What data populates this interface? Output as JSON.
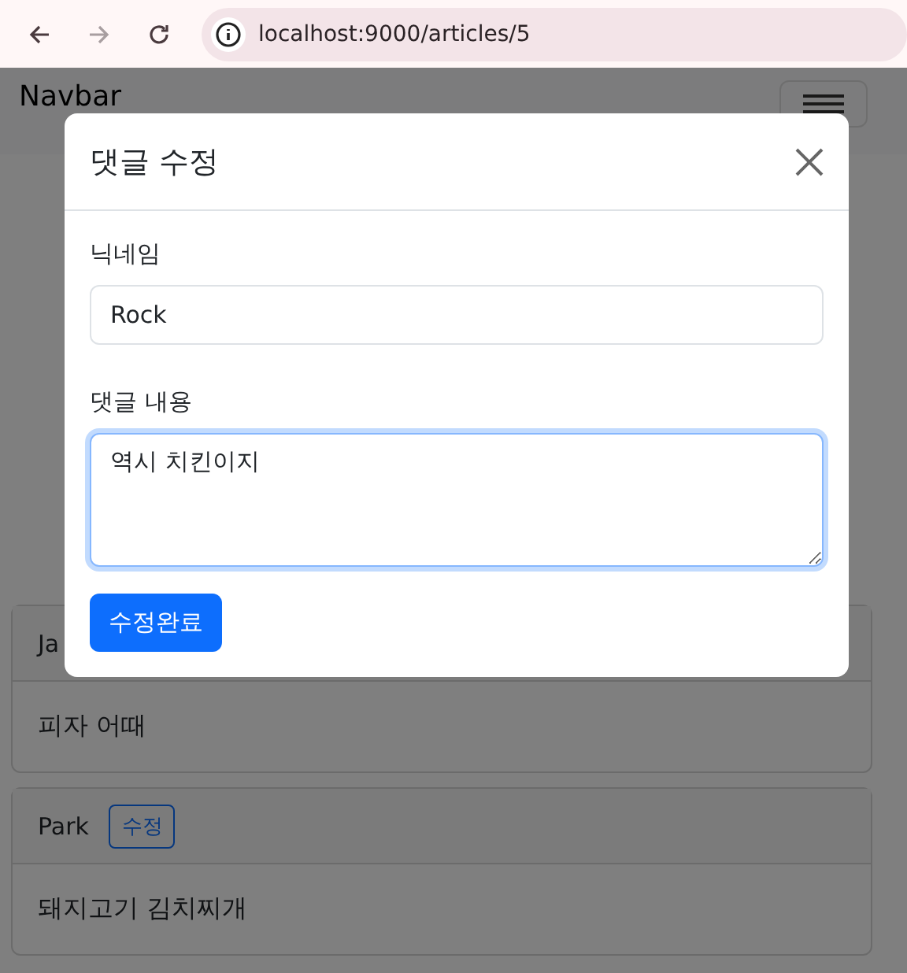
{
  "browser": {
    "url": "localhost:9000/articles/5",
    "back_enabled": true,
    "forward_enabled": false
  },
  "navbar": {
    "brand": "Navbar"
  },
  "comments": [
    {
      "author": "Ja",
      "body": "피자 어때"
    },
    {
      "author": "Park",
      "edit_button": "수정",
      "body": "돼지고기 김치찌개"
    }
  ],
  "modal": {
    "title": "댓글 수정",
    "fields": [
      {
        "label": "닉네임",
        "kind": "input",
        "value": "Rock",
        "focused": false
      },
      {
        "label": "댓글 내용",
        "kind": "textarea",
        "value": "역시 치킨이지",
        "focused": true
      }
    ],
    "submit": "수정완료"
  }
}
